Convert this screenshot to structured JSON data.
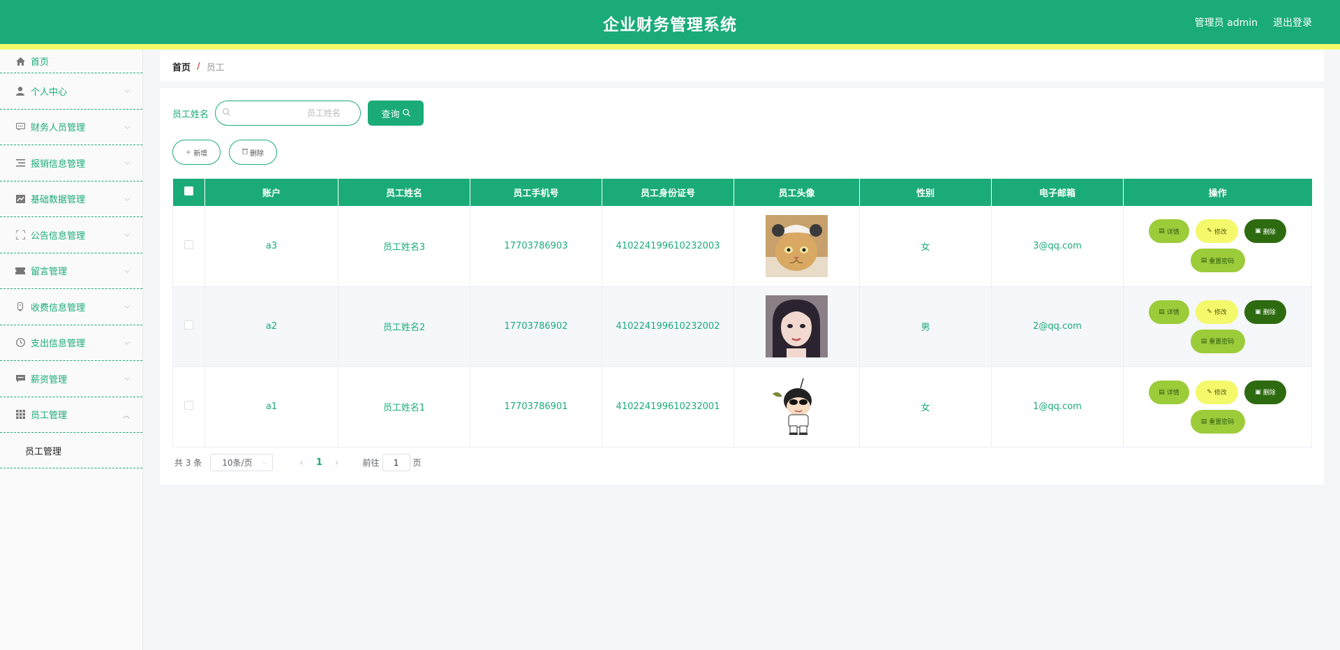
{
  "header": {
    "title": "企业财务管理系统",
    "user_label": "管理员 admin",
    "logout_label": "退出登录"
  },
  "sidebar": {
    "items": [
      {
        "label": "首页",
        "icon": "home-icon"
      },
      {
        "label": "个人中心",
        "icon": "user-icon"
      },
      {
        "label": "财务人员管理",
        "icon": "chat-icon"
      },
      {
        "label": "报销信息管理",
        "icon": "list-icon"
      },
      {
        "label": "基础数据管理",
        "icon": "chart-icon"
      },
      {
        "label": "公告信息管理",
        "icon": "fullscreen-icon"
      },
      {
        "label": "留言管理",
        "icon": "ticket-icon"
      },
      {
        "label": "收费信息管理",
        "icon": "bell-icon"
      },
      {
        "label": "支出信息管理",
        "icon": "clock-icon"
      },
      {
        "label": "薪资管理",
        "icon": "message-icon"
      },
      {
        "label": "员工管理",
        "icon": "grid-icon"
      }
    ],
    "submenu": {
      "label": "员工管理"
    }
  },
  "breadcrumb": {
    "home": "首页",
    "separator": "/",
    "current": "员工"
  },
  "search": {
    "label": "员工姓名",
    "placeholder": "员工姓名",
    "query_label": "查询"
  },
  "actions": {
    "add_label": "新增",
    "delete_label": "删除"
  },
  "table": {
    "columns": [
      "账户",
      "员工姓名",
      "员工手机号",
      "员工身份证号",
      "员工头像",
      "性别",
      "电子邮箱",
      "操作"
    ],
    "rows": [
      {
        "account": "a3",
        "name": "员工姓名3",
        "phone": "17703786903",
        "id_number": "410224199610232003",
        "avatar": "cat-avatar",
        "gender": "女",
        "email": "3@qq.com"
      },
      {
        "account": "a2",
        "name": "员工姓名2",
        "phone": "17703786902",
        "id_number": "410224199610232002",
        "avatar": "girl-avatar",
        "gender": "男",
        "email": "2@qq.com"
      },
      {
        "account": "a1",
        "name": "员工姓名1",
        "phone": "17703786901",
        "id_number": "410224199610232001",
        "avatar": "cartoon-avatar",
        "gender": "女",
        "email": "1@qq.com"
      }
    ],
    "row_actions": {
      "detail": "详情",
      "edit": "修改",
      "delete": "删除",
      "reset": "重置密码"
    }
  },
  "pagination": {
    "total": "共 3 条",
    "page_size": "10条/页",
    "current_page": "1",
    "goto_prefix": "前往",
    "goto_value": "1",
    "goto_suffix": "页"
  },
  "colors": {
    "primary": "#1aab79",
    "accent_yellow": "#f3f96b",
    "accent_lime": "#9ccc3a",
    "danger_dark": "#2e6b10"
  }
}
